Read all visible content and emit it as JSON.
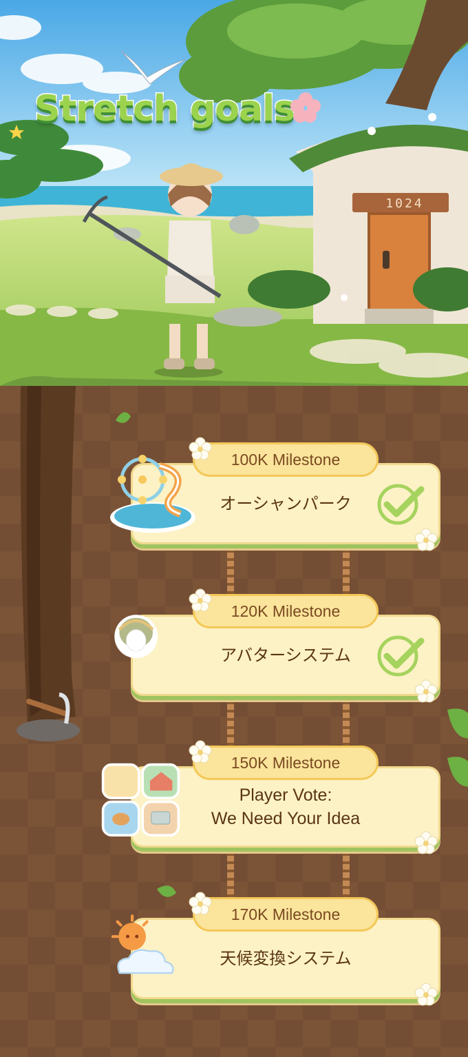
{
  "header": {
    "title": "Stretch goals"
  },
  "house": {
    "number": "1024"
  },
  "milestones": [
    {
      "badge": "100K Milestone",
      "text": "オーシャンパーク",
      "completed": true,
      "icon": "ferris-wheel-park-icon"
    },
    {
      "badge": "120K Milestone",
      "text": "アバターシステム",
      "completed": true,
      "icon": "avatar-head-icon"
    },
    {
      "badge": "150K Milestone",
      "text_line1": "Player Vote:",
      "text_line2": "We Need Your Idea",
      "completed": false,
      "icon": "vote-options-icon"
    },
    {
      "badge": "170K Milestone",
      "text": "天候変換システム",
      "completed": false,
      "icon": "weather-sun-cloud-icon"
    }
  ],
  "colors": {
    "card_bg": "#fdf2c5",
    "badge_bg": "#fbe49b",
    "check": "#a6d35e",
    "title_fill": "#9bd34f",
    "soil": "#7b5337"
  }
}
